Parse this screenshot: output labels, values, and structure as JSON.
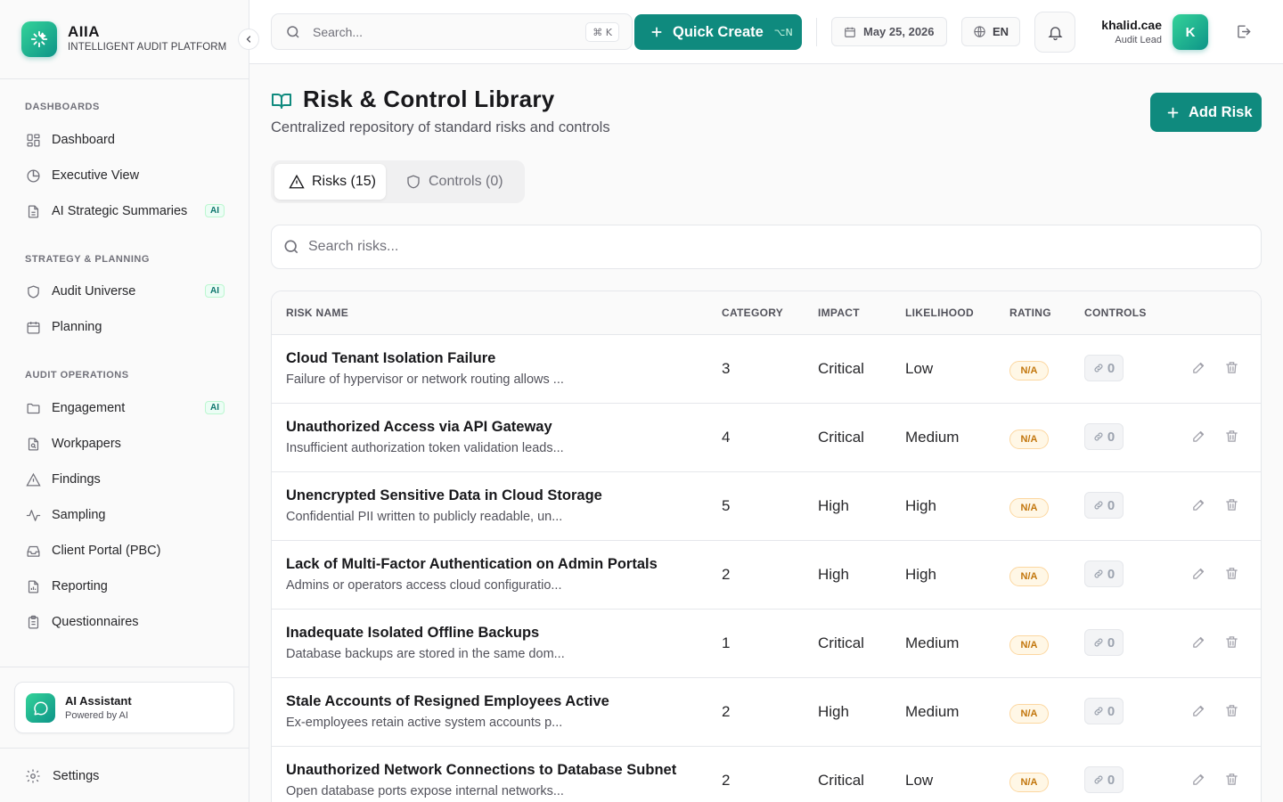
{
  "brand": {
    "name": "AIIA",
    "subtitle": "INTELLIGENT AUDIT PLATFORM"
  },
  "sidebar": {
    "sections": [
      {
        "title": "DASHBOARDS",
        "items": [
          {
            "label": "Dashboard",
            "icon": "dashboard-grid-icon",
            "badge": ""
          },
          {
            "label": "Executive View",
            "icon": "pie-chart-icon",
            "badge": ""
          },
          {
            "label": "AI Strategic Summaries",
            "icon": "document-icon",
            "badge": "AI"
          }
        ]
      },
      {
        "title": "STRATEGY & PLANNING",
        "items": [
          {
            "label": "Audit Universe",
            "icon": "shield-icon",
            "badge": "AI"
          },
          {
            "label": "Planning",
            "icon": "calendar-icon",
            "badge": ""
          }
        ]
      },
      {
        "title": "AUDIT OPERATIONS",
        "items": [
          {
            "label": "Engagement",
            "icon": "folder-icon",
            "badge": "AI"
          },
          {
            "label": "Workpapers",
            "icon": "file-search-icon",
            "badge": ""
          },
          {
            "label": "Findings",
            "icon": "warning-triangle-icon",
            "badge": ""
          },
          {
            "label": "Sampling",
            "icon": "activity-icon",
            "badge": ""
          },
          {
            "label": "Client Portal (PBC)",
            "icon": "inbox-icon",
            "badge": ""
          },
          {
            "label": "Reporting",
            "icon": "bar-chart-file-icon",
            "badge": ""
          },
          {
            "label": "Questionnaires",
            "icon": "clipboard-icon",
            "badge": ""
          }
        ]
      }
    ],
    "assistant": {
      "title": "AI Assistant",
      "subtitle": "Powered by AI"
    },
    "settings_label": "Settings"
  },
  "topbar": {
    "search_placeholder": "Search...",
    "search_shortcut": "⌘ K",
    "quick_create_label": "Quick Create",
    "quick_create_shortcut": "⌥N",
    "date": "May 25, 2026",
    "language": "EN",
    "user": {
      "name": "khalid.cae",
      "role": "Audit Lead",
      "initial": "K"
    }
  },
  "page": {
    "title": "Risk & Control Library",
    "subtitle": "Centralized repository of standard risks and controls",
    "add_button": "Add Risk",
    "tabs": [
      {
        "label": "Risks (15)",
        "active": true
      },
      {
        "label": "Controls (0)",
        "active": false
      }
    ],
    "search_placeholder": "Search risks..."
  },
  "table": {
    "columns": [
      "RISK NAME",
      "CATEGORY",
      "IMPACT",
      "LIKELIHOOD",
      "RATING",
      "CONTROLS"
    ],
    "rows": [
      {
        "name": "Cloud Tenant Isolation Failure",
        "desc": "Failure of hypervisor or network routing allows ...",
        "category": "3",
        "impact": "Critical",
        "likelihood": "Low",
        "rating": "N/A",
        "controls": "0"
      },
      {
        "name": "Unauthorized Access via API Gateway",
        "desc": "Insufficient authorization token validation leads...",
        "category": "4",
        "impact": "Critical",
        "likelihood": "Medium",
        "rating": "N/A",
        "controls": "0"
      },
      {
        "name": "Unencrypted Sensitive Data in Cloud Storage",
        "desc": "Confidential PII written to publicly readable, un...",
        "category": "5",
        "impact": "High",
        "likelihood": "High",
        "rating": "N/A",
        "controls": "0"
      },
      {
        "name": "Lack of Multi-Factor Authentication on Admin Portals",
        "desc": "Admins or operators access cloud configuratio...",
        "category": "2",
        "impact": "High",
        "likelihood": "High",
        "rating": "N/A",
        "controls": "0"
      },
      {
        "name": "Inadequate Isolated Offline Backups",
        "desc": "Database backups are stored in the same dom...",
        "category": "1",
        "impact": "Critical",
        "likelihood": "Medium",
        "rating": "N/A",
        "controls": "0"
      },
      {
        "name": "Stale Accounts of Resigned Employees Active",
        "desc": "Ex-employees retain active system accounts p...",
        "category": "2",
        "impact": "High",
        "likelihood": "Medium",
        "rating": "N/A",
        "controls": "0"
      },
      {
        "name": "Unauthorized Network Connections to Database Subnet",
        "desc": "Open database ports expose internal networks...",
        "category": "2",
        "impact": "Critical",
        "likelihood": "Low",
        "rating": "N/A",
        "controls": "0"
      }
    ]
  },
  "colors": {
    "accent": "#0f8a7e",
    "accent_light": "#34d399",
    "rating_text": "#c2760c",
    "rating_bg": "#fff7e6"
  }
}
